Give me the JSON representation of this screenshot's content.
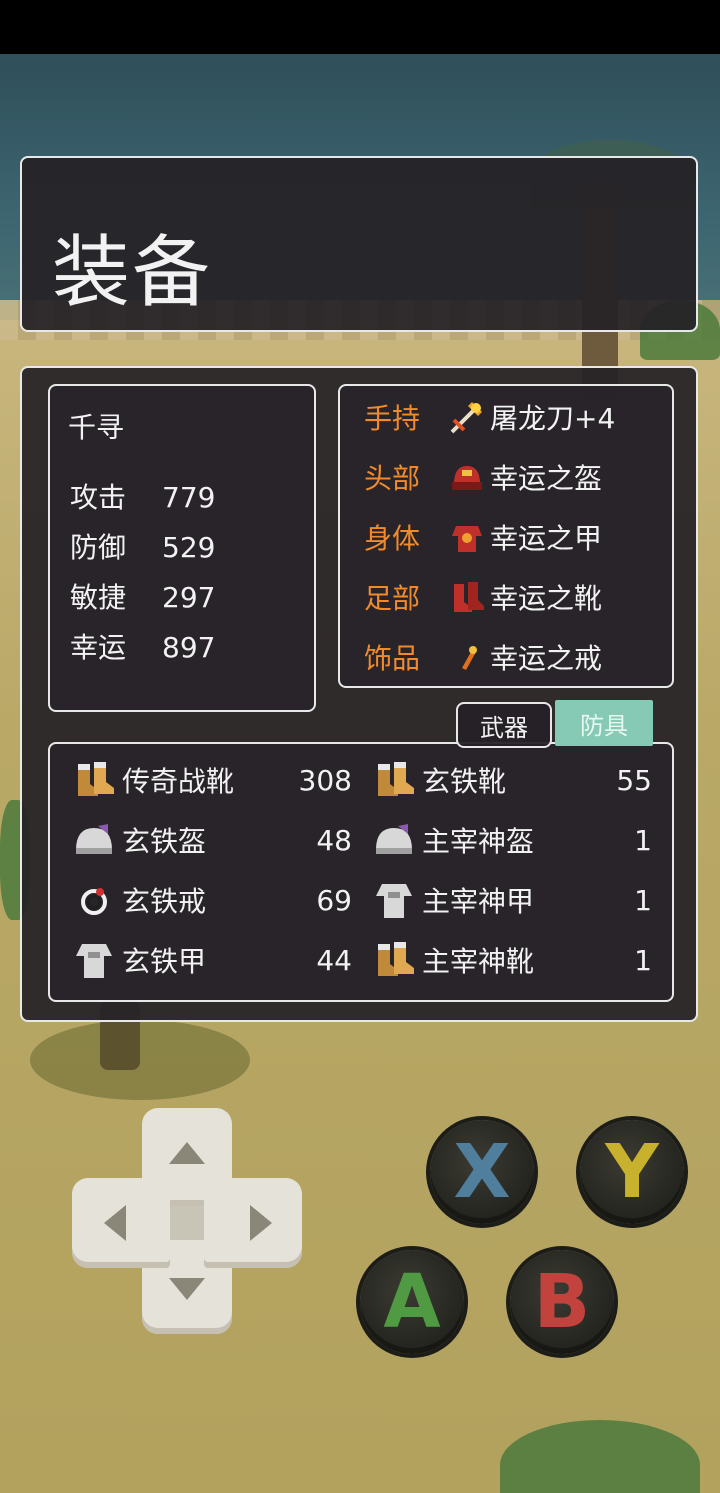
{
  "title": "装备",
  "character": {
    "name": "千寻",
    "stats": [
      {
        "label": "攻击",
        "value": "779"
      },
      {
        "label": "防御",
        "value": "529"
      },
      {
        "label": "敏捷",
        "value": "297"
      },
      {
        "label": "幸运",
        "value": "897"
      }
    ]
  },
  "slots": [
    {
      "label": "手持",
      "item": "屠龙刀+4",
      "icon": "flame-sword-icon"
    },
    {
      "label": "头部",
      "item": "幸运之盔",
      "icon": "red-helmet-icon"
    },
    {
      "label": "身体",
      "item": "幸运之甲",
      "icon": "red-armor-icon"
    },
    {
      "label": "足部",
      "item": "幸运之靴",
      "icon": "red-boots-icon"
    },
    {
      "label": "饰品",
      "item": "幸运之戒",
      "icon": "ring-icon"
    }
  ],
  "tabs": [
    {
      "label": "武器",
      "active": false
    },
    {
      "label": "防具",
      "active": true
    }
  ],
  "inventory": [
    {
      "name": "传奇战靴",
      "count": "308",
      "icon": "boots-icon"
    },
    {
      "name": "玄铁靴",
      "count": "55",
      "icon": "boots-icon"
    },
    {
      "name": "玄铁盔",
      "count": "48",
      "icon": "helmet-icon"
    },
    {
      "name": "主宰神盔",
      "count": "1",
      "icon": "helmet-icon"
    },
    {
      "name": "玄铁戒",
      "count": "69",
      "icon": "ring-icon"
    },
    {
      "name": "主宰神甲",
      "count": "1",
      "icon": "armor-icon"
    },
    {
      "name": "玄铁甲",
      "count": "44",
      "icon": "armor-icon"
    },
    {
      "name": "主宰神靴",
      "count": "1",
      "icon": "boots-icon"
    }
  ],
  "controls": {
    "buttons": [
      {
        "label": "X",
        "color": "#4f7f9d"
      },
      {
        "label": "Y",
        "color": "#c7b12d"
      },
      {
        "label": "A",
        "color": "#4f9a43"
      },
      {
        "label": "B",
        "color": "#c2423d"
      }
    ]
  },
  "colors": {
    "panel_bg": "#252126",
    "slot_label": "#f08a2a",
    "active_tab": "#86c9b4"
  }
}
